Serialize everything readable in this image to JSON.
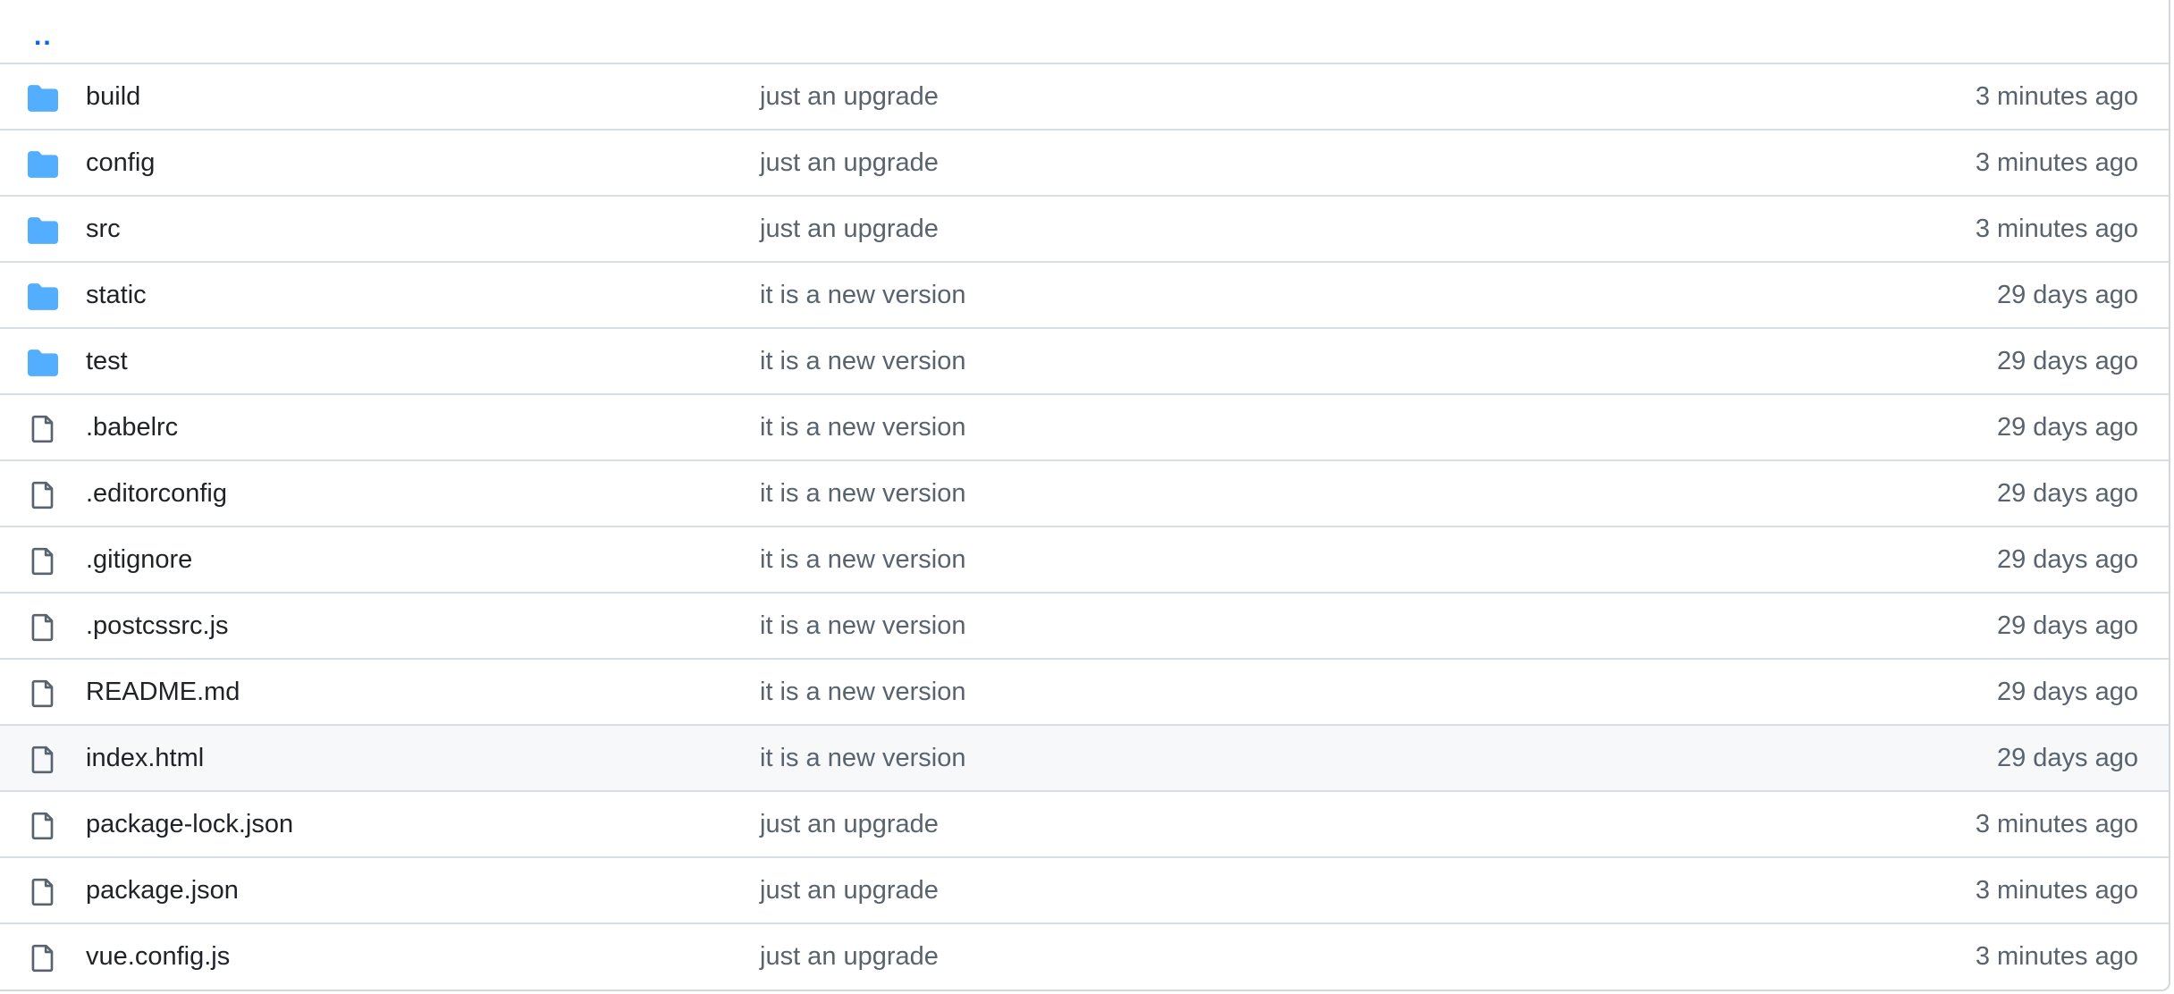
{
  "parent_link": "..",
  "colors": {
    "folder_icon": "#54aeff",
    "file_icon": "#59636e",
    "link": "#0969da",
    "border": "#d0d7de",
    "hover_row": "#f6f8fa"
  },
  "rows": [
    {
      "icon": "folder-icon",
      "name": "build",
      "message": "just an upgrade",
      "age": "3 minutes ago"
    },
    {
      "icon": "folder-icon",
      "name": "config",
      "message": "just an upgrade",
      "age": "3 minutes ago"
    },
    {
      "icon": "folder-icon",
      "name": "src",
      "message": "just an upgrade",
      "age": "3 minutes ago"
    },
    {
      "icon": "folder-icon",
      "name": "static",
      "message": "it is a new version",
      "age": "29 days ago"
    },
    {
      "icon": "folder-icon",
      "name": "test",
      "message": "it is a new version",
      "age": "29 days ago"
    },
    {
      "icon": "file-icon",
      "name": ".babelrc",
      "message": "it is a new version",
      "age": "29 days ago"
    },
    {
      "icon": "file-icon",
      "name": ".editorconfig",
      "message": "it is a new version",
      "age": "29 days ago"
    },
    {
      "icon": "file-icon",
      "name": ".gitignore",
      "message": "it is a new version",
      "age": "29 days ago"
    },
    {
      "icon": "file-icon",
      "name": ".postcssrc.js",
      "message": "it is a new version",
      "age": "29 days ago"
    },
    {
      "icon": "file-icon",
      "name": "README.md",
      "message": "it is a new version",
      "age": "29 days ago"
    },
    {
      "icon": "file-icon",
      "name": "index.html",
      "message": "it is a new version",
      "age": "29 days ago"
    },
    {
      "icon": "file-icon",
      "name": "package-lock.json",
      "message": "just an upgrade",
      "age": "3 minutes ago"
    },
    {
      "icon": "file-icon",
      "name": "package.json",
      "message": "just an upgrade",
      "age": "3 minutes ago"
    },
    {
      "icon": "file-icon",
      "name": "vue.config.js",
      "message": "just an upgrade",
      "age": "3 minutes ago"
    }
  ]
}
